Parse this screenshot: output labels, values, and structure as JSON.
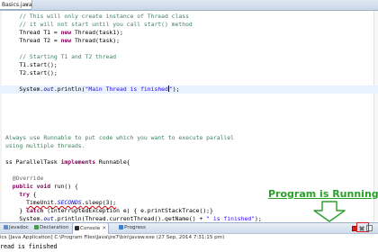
{
  "editor": {
    "tab_label": "Basics.java",
    "tab_close": "×",
    "code_lines": [
      [
        {
          "t": "    // This will only create instance of Thread class",
          "c": "comment"
        }
      ],
      [
        {
          "t": "    // it will not start until you call start() method",
          "c": "comment"
        }
      ],
      [
        {
          "t": "    Thread T1 = "
        },
        {
          "t": "new",
          "c": "kw"
        },
        {
          "t": " Thread(task1);"
        }
      ],
      [
        {
          "t": "    Thread T2 = "
        },
        {
          "t": "new",
          "c": "kw"
        },
        {
          "t": " Thread(task);"
        }
      ],
      [],
      [
        {
          "t": "    // Starting T1 and T2 thread",
          "c": "comment"
        }
      ],
      [
        {
          "t": "    T1.start();"
        }
      ],
      [
        {
          "t": "    T2.start();"
        }
      ],
      [],
      [
        {
          "t": "    System."
        },
        {
          "t": "out",
          "c": "field"
        },
        {
          "t": ".println("
        },
        {
          "t": "\"Main Thread is finished\"",
          "c": "str",
          "caret": true
        },
        {
          "t": ");"
        }
      ],
      [],
      [],
      [],
      [],
      [],
      [
        {
          "t": "Always use Runnable to put code which you want to execute parallel",
          "c": "comment"
        }
      ],
      [
        {
          "t": "using multiple threads.",
          "c": "comment"
        }
      ],
      [],
      [
        {
          "t": "ss ParallelTask "
        },
        {
          "t": "implements",
          "c": "kw"
        },
        {
          "t": " Runnable{"
        }
      ],
      [],
      [
        {
          "t": "  @Override",
          "c": "ann"
        }
      ],
      [
        {
          "t": "  "
        },
        {
          "t": "public",
          "c": "kw"
        },
        {
          "t": " "
        },
        {
          "t": "void",
          "c": "kw"
        },
        {
          "t": " run() {"
        }
      ],
      [
        {
          "t": "    "
        },
        {
          "t": "try",
          "c": "kw"
        },
        {
          "t": " {"
        }
      ],
      [
        {
          "t": "      "
        },
        {
          "t": "TimeUnit.",
          "c": "err"
        },
        {
          "t": "SECONDS",
          "c": "field err"
        },
        {
          "t": ".sleep(3);",
          "c": "err"
        }
      ],
      [
        {
          "t": "    } "
        },
        {
          "t": "catch",
          "c": "kw"
        },
        {
          "t": " (InterruptedException e) { e.printStackTrace();}"
        }
      ],
      [
        {
          "t": "    System."
        },
        {
          "t": "out",
          "c": "field"
        },
        {
          "t": ".println(Thread.currentThread().getName() + "
        },
        {
          "t": "\" is finished\"",
          "c": "str"
        },
        {
          "t": ");"
        }
      ],
      [],
      [
        {
          "t": "  }"
        }
      ],
      [],
      [
        {
          "t": "}"
        }
      ]
    ],
    "current_line_index": 9
  },
  "annotation": {
    "label": "Program is Running",
    "color": "#2aa02a"
  },
  "views": {
    "tabs": [
      {
        "label": "Javadoc",
        "icon": "javadoc-icon"
      },
      {
        "label": "Declaration",
        "icon": "declaration-icon"
      },
      {
        "label": "Console",
        "icon": "console-icon",
        "active": true
      },
      {
        "label": "Progress",
        "icon": "progress-icon"
      }
    ],
    "console_close": "×",
    "controls": [
      "terminate-icon",
      "remove-launch-icon",
      "pin-console-icon"
    ]
  },
  "console": {
    "header": "ics [Java Application] C:\\Program Files\\Java\\jre7\\bin\\javaw.exe (27 Sep, 2014 7:31:15 pm)",
    "output": "read is finished"
  },
  "colors": {
    "comment": "#3f7f5f",
    "keyword": "#7f0055",
    "string": "#2a00ff",
    "field": "#0000c0",
    "terminate": "#d61f1f",
    "current_line": "#e8f2fe"
  }
}
